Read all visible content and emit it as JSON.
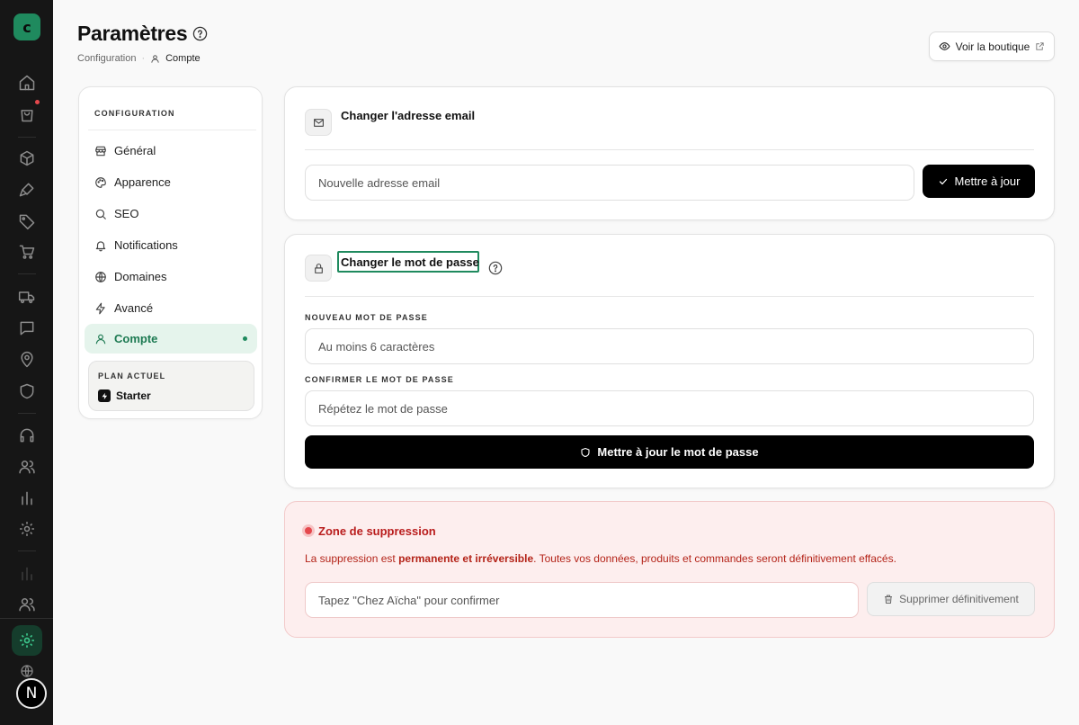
{
  "app": {
    "logo_letter": "c",
    "user_initial": "N"
  },
  "header": {
    "title": "Paramètres",
    "breadcrumb": {
      "parent": "Configuration",
      "current": "Compte"
    },
    "shop_button": "Voir la boutique"
  },
  "sidebar": {
    "section_title": "CONFIGURATION",
    "items": [
      {
        "label": "Général",
        "icon": "store-icon"
      },
      {
        "label": "Apparence",
        "icon": "palette-icon"
      },
      {
        "label": "SEO",
        "icon": "search-icon"
      },
      {
        "label": "Notifications",
        "icon": "bell-icon"
      },
      {
        "label": "Domaines",
        "icon": "globe-icon"
      },
      {
        "label": "Avancé",
        "icon": "zap-icon"
      },
      {
        "label": "Compte",
        "icon": "user-icon",
        "active": true
      }
    ],
    "plan": {
      "label": "PLAN ACTUEL",
      "value": "Starter"
    }
  },
  "email_card": {
    "title": "Changer l'adresse email",
    "input_placeholder": "Nouvelle adresse email",
    "button": "Mettre à jour"
  },
  "password_card": {
    "title": "Changer le mot de passe",
    "new_label": "NOUVEAU MOT DE PASSE",
    "new_placeholder": "Au moins 6 caractères",
    "confirm_label": "CONFIRMER LE MOT DE PASSE",
    "confirm_placeholder": "Répétez le mot de passe",
    "button": "Mettre à jour le mot de passe"
  },
  "danger_zone": {
    "title": "Zone de suppression",
    "desc_start": "La suppression est ",
    "desc_bold": "permanente et irréversible",
    "desc_end": ". Toutes vos données, produits et commandes seront définitivement effacés.",
    "input_placeholder": "Tapez \"Chez Aïcha\" pour confirmer",
    "button": "Supprimer définitivement"
  },
  "colors": {
    "accent": "#1f8a5e",
    "active_bg": "#e5f4ec",
    "danger": "#b91c1c",
    "danger_bg": "#fdeeee",
    "rail_bg": "#161616"
  }
}
